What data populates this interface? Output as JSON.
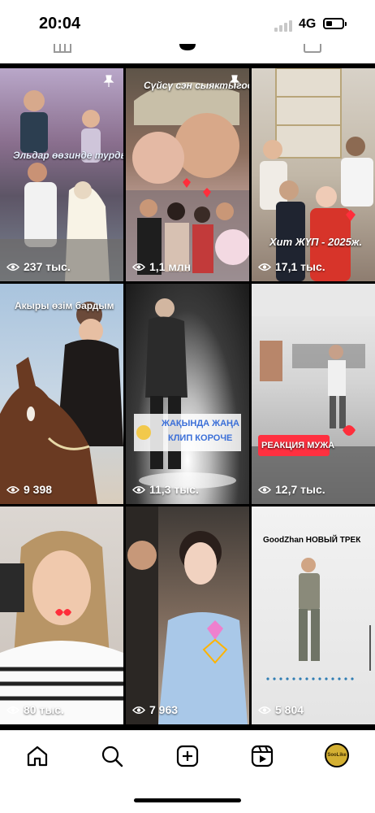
{
  "status_bar": {
    "time": "20:04",
    "network": "4G",
    "battery_level": 0.4
  },
  "tabs": [
    {
      "name": "grid-tab",
      "icon": "grid-icon"
    },
    {
      "name": "reels-tab",
      "icon": "reels-icon",
      "selected": true
    },
    {
      "name": "tagged-tab",
      "icon": "tagged-icon"
    }
  ],
  "tiles": [
    {
      "views": "237 тыс.",
      "caption": "Эльдар өөзинде турды",
      "pinned": true
    },
    {
      "views": "1,1 млн",
      "caption": "Сүйсү сэн сыяктыгоо",
      "pinned": true
    },
    {
      "views": "17,1 тыс.",
      "caption": "Хит ЖҮП - 2025ж.",
      "pinned": false
    },
    {
      "views": "9 398",
      "caption": "Акыры өзім бардым",
      "pinned": false
    },
    {
      "views": "11,3 тыс.",
      "caption_line1": "ЖАҚЫНДА ЖАҢА",
      "caption_line2": "КЛИП КОРОЧЕ",
      "pinned": false
    },
    {
      "views": "12,7 тыс.",
      "caption": "РЕАКЦИЯ МУЖА",
      "pinned": false
    },
    {
      "views": "80 тыс.",
      "caption": "",
      "pinned": false
    },
    {
      "views": "7 963",
      "caption": "",
      "pinned": false
    },
    {
      "views": "5 804",
      "caption": "GoodZhan НОВЫЙ ТРЕК",
      "pinned": false
    }
  ],
  "bottom_nav": {
    "items": [
      "home-icon",
      "search-icon",
      "create-icon",
      "reels-icon",
      "profile-avatar"
    ],
    "avatar_text": "SooLike"
  },
  "colors": {
    "accent_heart": "#ff2e3b",
    "reaction_banner": "#ff3040",
    "clip_banner_text": "#3b6fd8"
  }
}
